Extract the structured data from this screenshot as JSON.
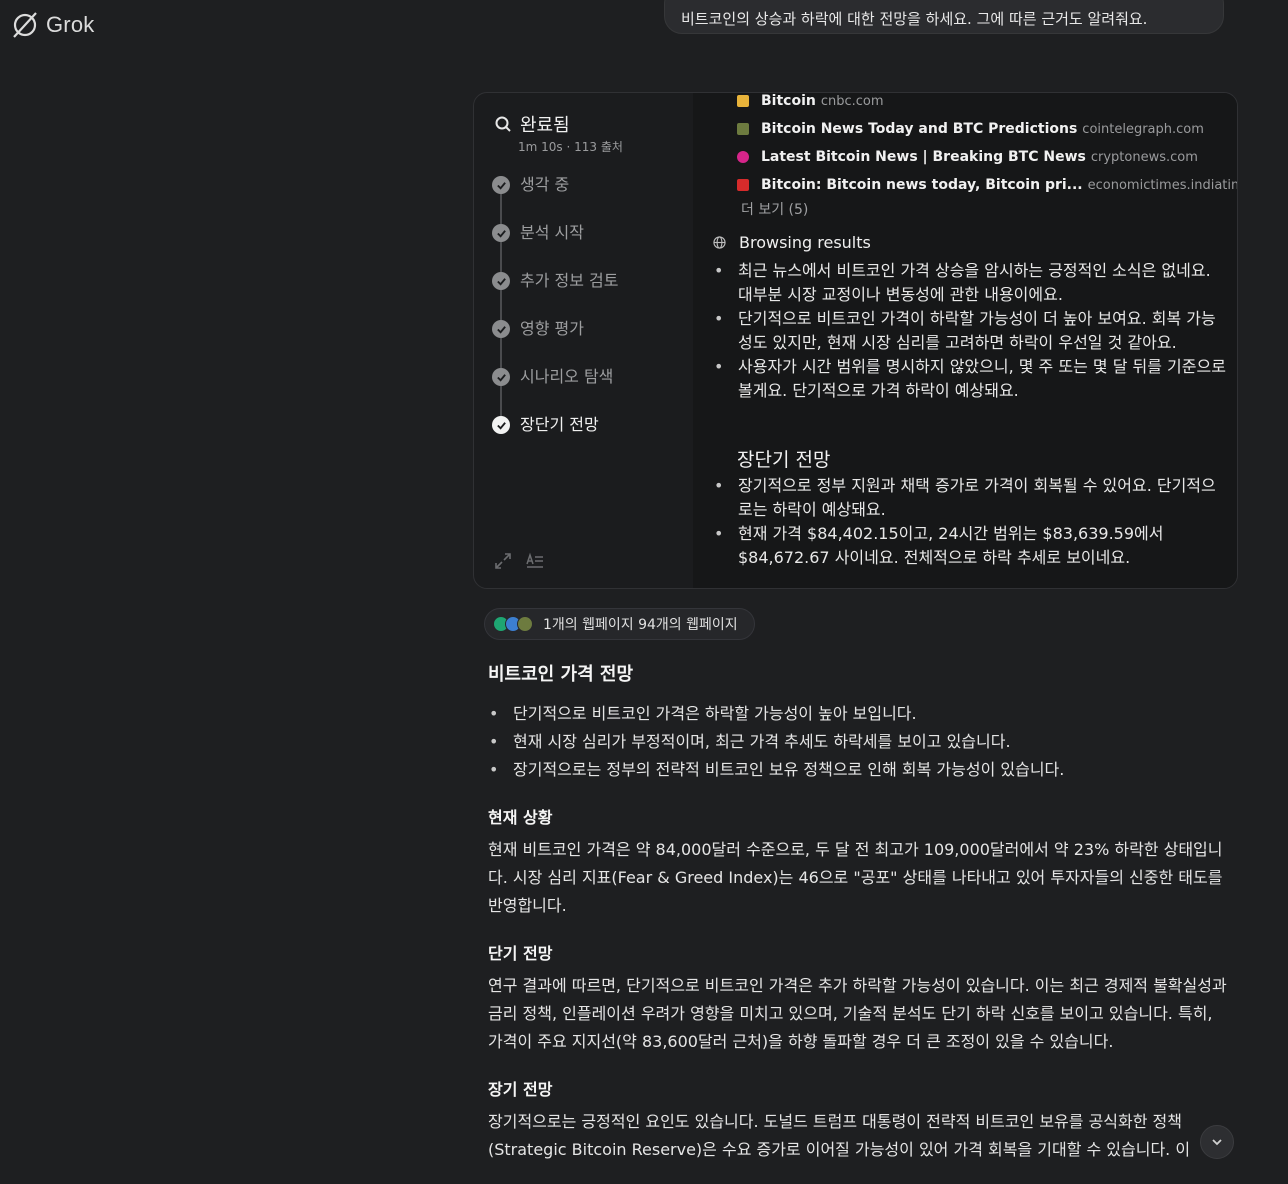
{
  "app": {
    "name": "Grok"
  },
  "user_message": "비트코인의 상승과 하락에 대한 전망을 하세요. 그에 따른 근거도 알려줘요.",
  "thinking": {
    "status": "완료됨",
    "meta": "1m 10s · 113 출처",
    "steps": [
      {
        "label": "생각 중"
      },
      {
        "label": "분석 시작"
      },
      {
        "label": "추가 정보 검토"
      },
      {
        "label": "영향 평가"
      },
      {
        "label": "시나리오 탐색"
      },
      {
        "label": "장단기 전망"
      }
    ],
    "sources": [
      {
        "title": "Bitcoin",
        "host": "cnbc.com",
        "color": "#e8b33a"
      },
      {
        "title": "Bitcoin News Today and BTC Predictions",
        "host": "cointelegraph.com",
        "color": "#6d7b3f"
      },
      {
        "title": "Latest Bitcoin News | Breaking BTC News",
        "host": "cryptonews.com",
        "color": "#d6258a"
      },
      {
        "title": "Bitcoin: Bitcoin news today, Bitcoin pri...",
        "host": "economictimes.indiatimes.com",
        "color": "#d62b2b"
      }
    ],
    "more_label": "더 보기 (5)",
    "browsing_header": "Browsing results",
    "browsing_bullets": [
      "최근 뉴스에서 비트코인 가격 상승을 암시하는 긍정적인 소식은 없네요. 대부분 시장 교정이나 변동성에 관한 내용이에요.",
      "단기적으로 비트코인 가격이 하락할 가능성이 더 높아 보여요. 회복 가능성도 있지만, 현재 시장 심리를 고려하면 하락이 우선일 것 같아요.",
      "사용자가 시간 범위를 명시하지 않았으니, 몇 주 또는 몇 달 뒤를 기준으로 볼게요. 단기적으로 가격 하락이 예상돼요."
    ],
    "subheading": "장단기 전망",
    "sub_bullets": [
      "장기적으로 정부 지원과 채택 증가로 가격이 회복될 수 있어요. 단기적으로는 하락이 예상돼요.",
      "현재 가격 $84,402.15이고, 24시간 범위는 $83,639.59에서 $84,672.67 사이네요. 전체적으로 하락 추세로 보이네요."
    ]
  },
  "webpages_label": "1개의 웹페이지 94개의 웹페이지",
  "answer": {
    "title": "비트코인 가격 전망",
    "bullets": [
      "단기적으로 비트코인 가격은 하락할 가능성이 높아 보입니다.",
      "현재 시장 심리가 부정적이며, 최근 가격 추세도 하락세를 보이고 있습니다.",
      "장기적으로는 정부의 전략적 비트코인 보유 정책으로 인해 회복 가능성이 있습니다."
    ],
    "sections": [
      {
        "heading": "현재 상황",
        "text": "현재 비트코인 가격은 약 84,000달러 수준으로, 두 달 전 최고가 109,000달러에서 약 23% 하락한 상태입니다. 시장 심리 지표(Fear & Greed Index)는 46으로 \"공포\" 상태를 나타내고 있어 투자자들의 신중한 태도를 반영합니다."
      },
      {
        "heading": "단기 전망",
        "text": "연구 결과에 따르면, 단기적으로 비트코인 가격은 추가 하락할 가능성이 있습니다. 이는 최근 경제적 불확실성과 금리 정책, 인플레이션 우려가 영향을 미치고 있으며, 기술적 분석도 단기 하락 신호를 보이고 있습니다. 특히, 가격이 주요 지지선(약 83,600달러 근처)을 하향 돌파할 경우 더 큰 조정이 있을 수 있습니다."
      },
      {
        "heading": "장기 전망",
        "text": "장기적으로는 긍정적인 요인도 있습니다. 도널드 트럼프 대통령이 전략적 비트코인 보유를 공식화한 정책(Strategic Bitcoin Reserve)은 수요 증가로 이어질 가능성이 있어 가격 회복을 기대할 수 있습니다. 이"
      }
    ]
  }
}
